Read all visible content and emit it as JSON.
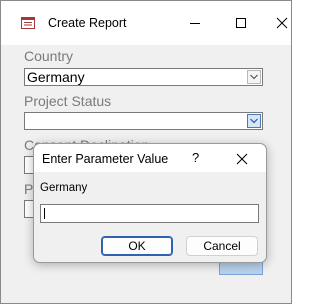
{
  "window": {
    "title": "Create Report",
    "icon": "form-icon",
    "controls": [
      "minimize-icon",
      "maximize-icon",
      "close-icon"
    ]
  },
  "form": {
    "country": {
      "label": "Country",
      "value": "Germany"
    },
    "project_status": {
      "label": "Project Status",
      "value": ""
    },
    "consent_declination": {
      "label": "Consent Declination"
    },
    "fourth_field": {
      "label": "P"
    }
  },
  "dialog": {
    "title": "Enter Parameter Value",
    "help": "?",
    "prompt": "Germany",
    "input_value": "",
    "ok_label": "OK",
    "cancel_label": "Cancel"
  },
  "colors": {
    "accent": "#2f62b3",
    "dropdown_active": "#d7e6f7",
    "window_bg": "#f0f0f0"
  }
}
